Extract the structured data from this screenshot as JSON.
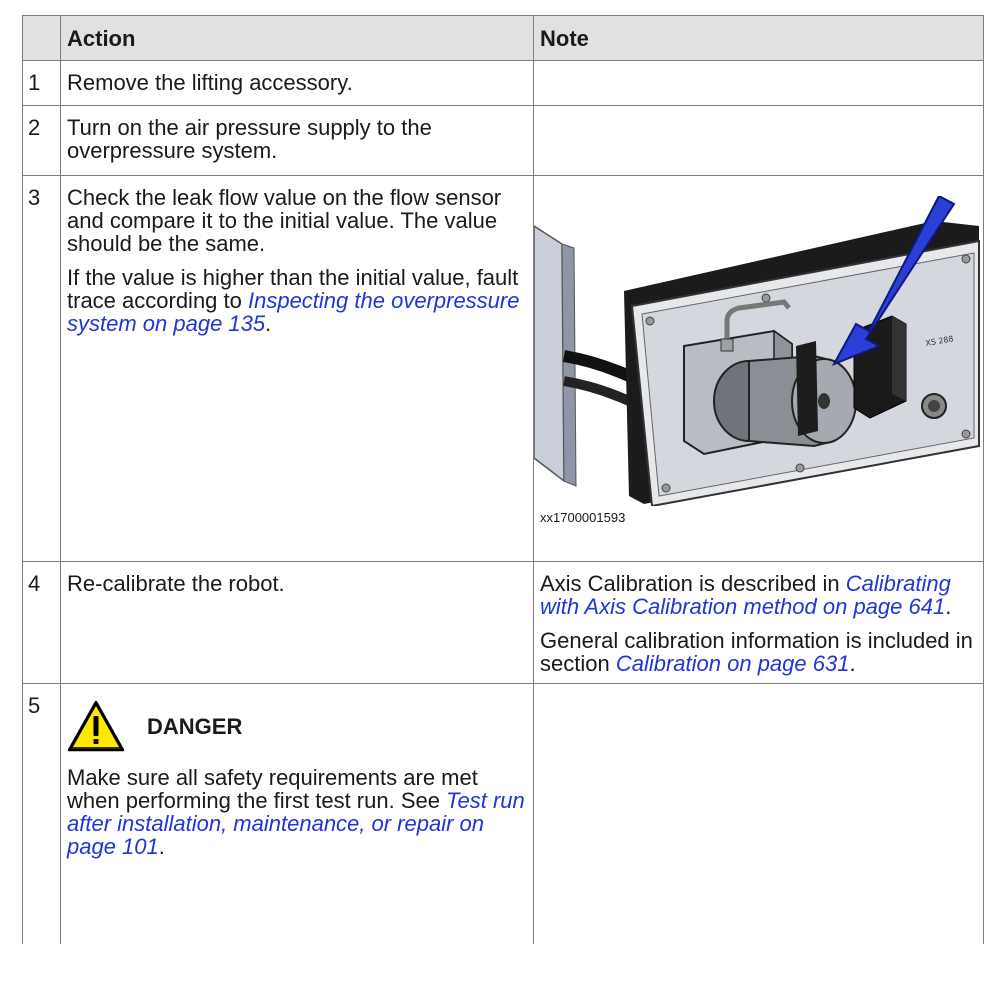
{
  "table": {
    "headers": {
      "num": "",
      "action": "Action",
      "note": "Note"
    },
    "rows": [
      {
        "num": "1",
        "action": [
          "Remove the lifting accessory."
        ]
      },
      {
        "num": "2",
        "action": [
          "Turn on the air pressure supply to the overpressure system."
        ]
      },
      {
        "num": "3",
        "action_p1": "Check the leak flow value on the flow sensor and compare it to the initial value. The value should be the same.",
        "action_p2_pre": "If the value is higher than the initial value, fault trace according to ",
        "action_p2_link": "Inspecting the overpressure system on page 135",
        "action_p2_post": ".",
        "figure_caption": "xx1700001593"
      },
      {
        "num": "4",
        "action": "Re-calibrate the robot.",
        "note_p1_pre": "Axis Calibration is described in ",
        "note_p1_link": "Calibrating with Axis Calibration method on page 641",
        "note_p1_post": ".",
        "note_p2_pre": "General calibration information is included in section ",
        "note_p2_link": "Calibration on page 631",
        "note_p2_post": "."
      },
      {
        "num": "5",
        "danger_title": "DANGER",
        "text_pre": "Make sure all safety requirements are met when performing the first test run. See ",
        "text_link": "Test run after installation, maintenance, or repair on page 101",
        "text_post": "."
      }
    ]
  },
  "colors": {
    "link": "#1f35d8",
    "header_bg": "#e1e1e1",
    "warning_yellow": "#ffe800",
    "arrow_blue": "#2a3fd6"
  }
}
